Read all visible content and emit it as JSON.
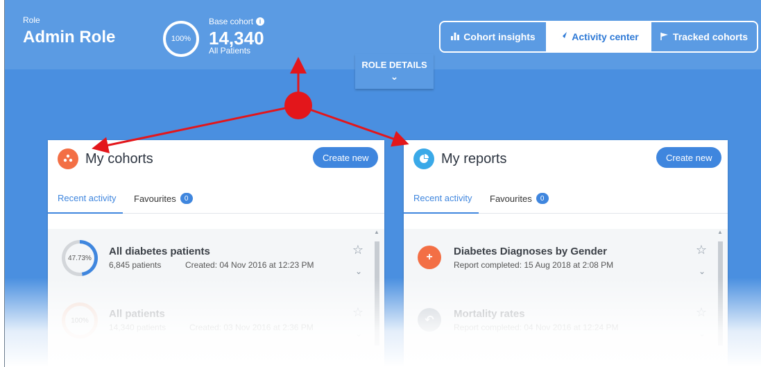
{
  "header": {
    "role_caption": "Role",
    "role_name": "Admin Role",
    "cohort_pct": "100%",
    "base_caption": "Base cohort",
    "base_count": "14,340",
    "base_sub": "All Patients",
    "role_details_label": "ROLE DETAILS"
  },
  "nav": {
    "items": [
      {
        "label": "Cohort insights",
        "icon": "bar-chart-icon",
        "active": false
      },
      {
        "label": "Activity center",
        "icon": "rocket-icon",
        "active": true
      },
      {
        "label": "Tracked cohorts",
        "icon": "flag-icon",
        "active": false
      }
    ]
  },
  "cohorts": {
    "title": "My cohorts",
    "create_label": "Create new",
    "tab_recent": "Recent activity",
    "tab_favourites": "Favourites",
    "favourites_count": "0",
    "items": [
      {
        "name": "All diabetes patients",
        "pct": "47.73%",
        "pct_value": 47.73,
        "patients": "6,845 patients",
        "created": "Created: 04 Nov 2016 at 12:23 PM"
      },
      {
        "name": "All patients",
        "pct": "100%",
        "pct_value": 100,
        "patients": "14,340 patients",
        "created": "Created: 03 Nov 2016 at 2:36 PM"
      }
    ]
  },
  "reports": {
    "title": "My reports",
    "create_label": "Create new",
    "tab_recent": "Recent activity",
    "tab_favourites": "Favourites",
    "favourites_count": "0",
    "items": [
      {
        "name": "Diabetes Diagnoses by Gender",
        "status": "Report completed: 15 Aug 2018 at 2:08 PM"
      },
      {
        "name": "Mortality rates",
        "status": "Report completed: 04 Nov 2016 at 12:24 PM"
      }
    ]
  },
  "colors": {
    "brand_blue": "#4a8fe0",
    "header_blue": "#5b9be3",
    "button_blue": "#3f86de",
    "cohort_orange": "#f36f45",
    "report_teal": "#3aa9e8",
    "annotation_red": "#e3161b"
  }
}
